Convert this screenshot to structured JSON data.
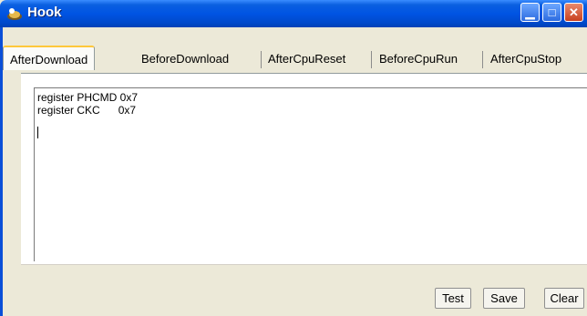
{
  "window": {
    "title": "Hook"
  },
  "tabs": [
    {
      "label": "AfterDownload",
      "active": true
    },
    {
      "label": "BeforeDownload",
      "active": false
    },
    {
      "label": "AfterCpuReset",
      "active": false
    },
    {
      "label": "BeforeCpuRun",
      "active": false
    },
    {
      "label": "AfterCpuStop",
      "active": false
    }
  ],
  "editor": {
    "lines": [
      "register PHCMD 0x7",
      "register CKC      0x7"
    ]
  },
  "buttons": {
    "test": "Test",
    "save": "Save",
    "clear": "Clear"
  },
  "colors": {
    "titlebar": "#0054e3",
    "active_tab_accent": "#ffc83c"
  }
}
